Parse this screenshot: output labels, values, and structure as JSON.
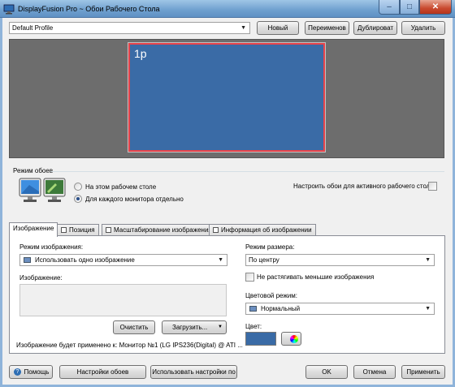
{
  "window": {
    "title": "DisplayFusion Pro ~ Обои Рабочего Стола",
    "minimize_glyph": "–",
    "maximize_glyph": "□",
    "close_glyph": "✕"
  },
  "profile": {
    "selected": "Default Profile",
    "new_label": "Новый",
    "rename_label": "Переименов",
    "duplicate_label": "Дублироват",
    "delete_label": "Удалить"
  },
  "preview": {
    "monitor_label": "1p"
  },
  "wallpaper_mode": {
    "title": "Режим обоев",
    "option_same": "На этом рабочем столе",
    "option_each": "Для каждого монитора отдельно",
    "selected": "option_each",
    "active_desktop_label": "Настроить обои для активного рабочего стола",
    "active_desktop_checked": false
  },
  "tabs": [
    {
      "label": "Изображение",
      "active": true
    },
    {
      "label": "Позиция",
      "active": false
    },
    {
      "label": "Масштабирование изображения",
      "active": false
    },
    {
      "label": "Информация об изображении",
      "active": false
    }
  ],
  "image_tab": {
    "image_mode_label": "Режим изображения:",
    "image_mode_value": "Использовать одно изображение",
    "image_label": "Изображение:",
    "clear_label": "Очистить",
    "load_label": "Загрузить...",
    "status_text": "Изображение будет применено к: Монитор №1 (LG IPS236(Digital) @ ATI ...",
    "size_mode_label": "Режим размера:",
    "size_mode_value": "По центру",
    "no_stretch_label": "Не растягивать меньшие изображения",
    "no_stretch_checked": false,
    "color_mode_label": "Цветовой режим:",
    "color_mode_value": "Нормальный",
    "color_label": "Цвет:",
    "color_value": "#3a6ba6"
  },
  "footer": {
    "help_label": "Помощь",
    "settings_label": "Настройки обоев",
    "use_settings_label": "Использовать настройки по",
    "ok_label": "OK",
    "cancel_label": "Отмена",
    "apply_label": "Применить"
  },
  "colors": {
    "titlebar": "#7ba7d4",
    "preview_bg": "#6d6d6d",
    "monitor_fill": "#3a6ba6",
    "monitor_border": "#e8434a"
  }
}
